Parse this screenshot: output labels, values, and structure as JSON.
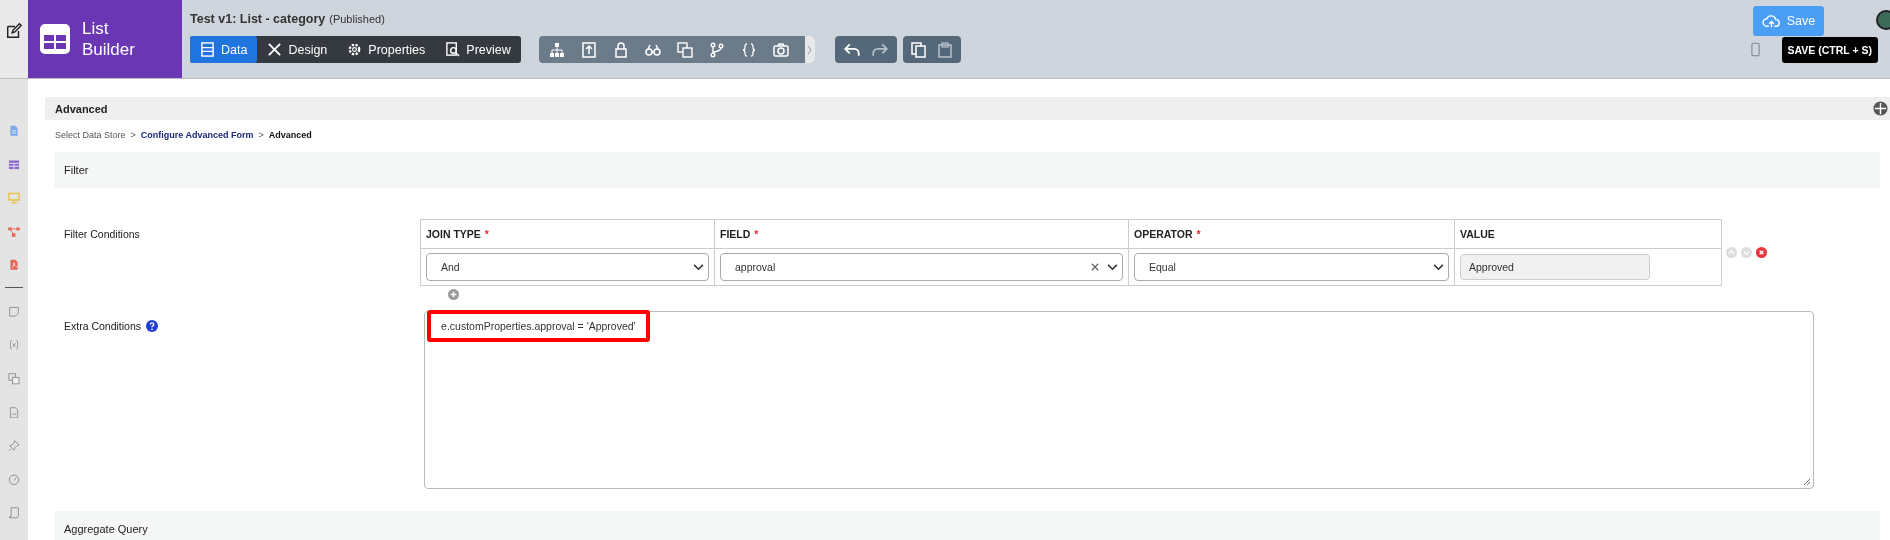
{
  "app": {
    "name_line1": "List",
    "name_line2": "Builder"
  },
  "header": {
    "title": "Test v1: List - category",
    "status": "(Published)"
  },
  "tabs": [
    {
      "label": "Data",
      "selected": true
    },
    {
      "label": "Design",
      "selected": false
    },
    {
      "label": "Properties",
      "selected": false
    },
    {
      "label": "Preview",
      "selected": false
    }
  ],
  "save": {
    "label": "Save",
    "tooltip": "SAVE (CTRL + S)"
  },
  "panel": {
    "title": "Advanced"
  },
  "breadcrumb": [
    {
      "label": "Select Data Store",
      "kind": "plain"
    },
    {
      "separator": ">",
      "label": "Configure Advanced Form",
      "kind": "link"
    },
    {
      "separator": ">",
      "label": "Advanced",
      "kind": "current"
    }
  ],
  "filter_section": {
    "title": "Filter"
  },
  "filter_conditions": {
    "label": "Filter Conditions",
    "columns": [
      {
        "label": "JOIN TYPE",
        "required_mark": "*"
      },
      {
        "label": "FIELD",
        "required_mark": "*"
      },
      {
        "label": "OPERATOR",
        "required_mark": "*"
      },
      {
        "label": "VALUE"
      }
    ],
    "rows": [
      {
        "join_type": "And",
        "field": "approval",
        "operator": "Equal",
        "value": "Approved"
      }
    ]
  },
  "extra_conditions": {
    "label": "Extra Conditions",
    "value": "e.customProperties.approval = 'Approved'",
    "highlighted": true
  },
  "next_section": {
    "title": "Aggregate Query"
  }
}
